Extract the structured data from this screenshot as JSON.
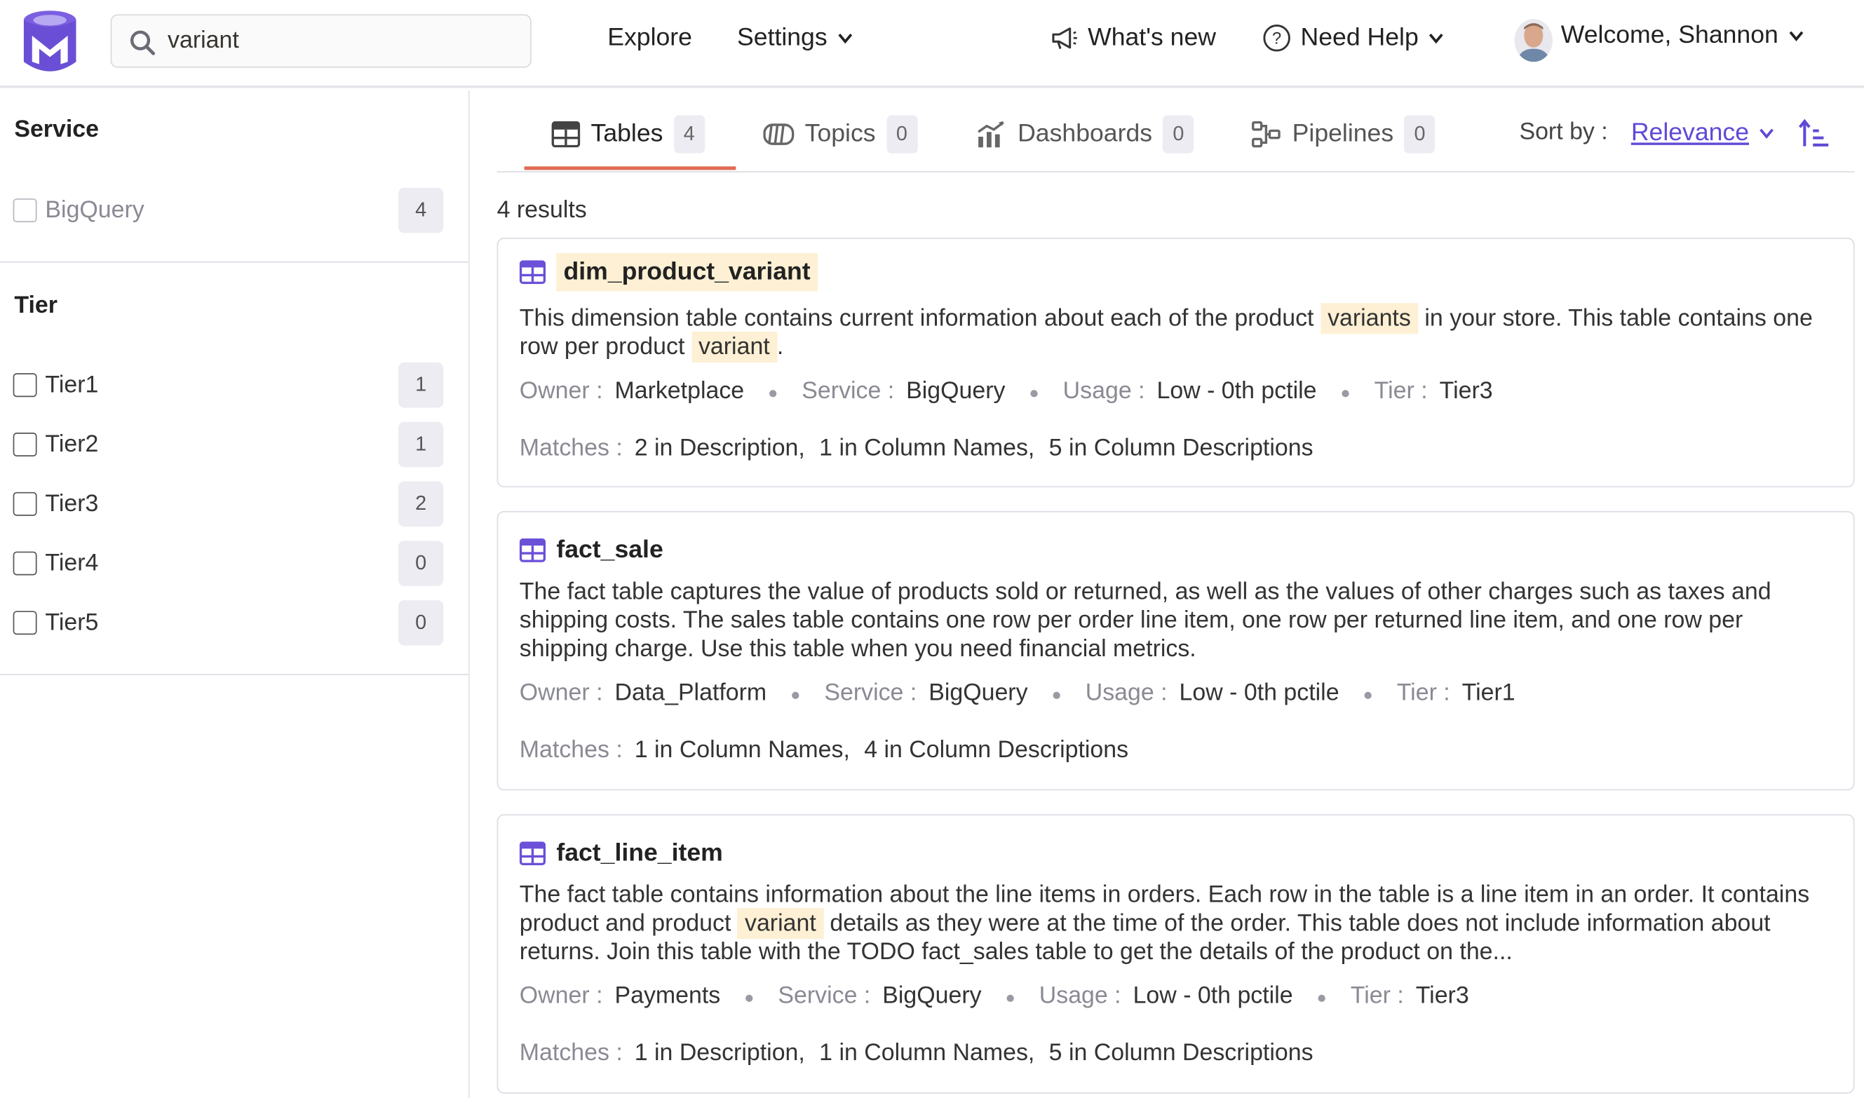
{
  "search": {
    "value": "variant"
  },
  "nav": {
    "explore": "Explore",
    "settings": "Settings",
    "whats_new": "What's new",
    "need_help": "Need Help",
    "welcome": "Welcome, Shannon"
  },
  "sidebar": {
    "service_title": "Service",
    "services": [
      {
        "label": "BigQuery",
        "count": "4"
      }
    ],
    "tier_title": "Tier",
    "tiers": [
      {
        "label": "Tier1",
        "count": "1"
      },
      {
        "label": "Tier2",
        "count": "1"
      },
      {
        "label": "Tier3",
        "count": "2"
      },
      {
        "label": "Tier4",
        "count": "0"
      },
      {
        "label": "Tier5",
        "count": "0"
      }
    ]
  },
  "tabs": [
    {
      "label": "Tables",
      "count": "4",
      "icon": "table-icon"
    },
    {
      "label": "Topics",
      "count": "0",
      "icon": "topic-icon"
    },
    {
      "label": "Dashboards",
      "count": "0",
      "icon": "dashboard-icon"
    },
    {
      "label": "Pipelines",
      "count": "0",
      "icon": "pipeline-icon"
    }
  ],
  "sort": {
    "label": "Sort by :",
    "value": "Relevance"
  },
  "results_count": "4 results",
  "meta_labels": {
    "owner": "Owner :",
    "service": "Service :",
    "usage": "Usage :",
    "tier": "Tier :",
    "matches": "Matches :"
  },
  "cards": [
    {
      "title": "dim_product_variant",
      "desc": [
        "This dimension table contains current information about each of the product ",
        "variants",
        " in your store. This table contains one row per product ",
        "variant",
        "."
      ],
      "owner": "Marketplace",
      "service": "BigQuery",
      "usage": "Low - 0th pctile",
      "tier": "Tier3",
      "matches": [
        "2 in Description,",
        "1 in Column Names,",
        "5 in Column Descriptions"
      ]
    },
    {
      "title": "fact_sale",
      "desc": [
        "The fact table captures the value of products sold or returned, as well as the values of other charges such as taxes and shipping costs. The sales table contains one row per order line item, one row per returned line item, and one row per shipping charge. Use this table when you need financial metrics."
      ],
      "owner": "Data_Platform",
      "service": "BigQuery",
      "usage": "Low - 0th pctile",
      "tier": "Tier1",
      "matches": [
        "1 in Column Names,",
        "4 in Column Descriptions"
      ]
    },
    {
      "title": "fact_line_item",
      "desc": [
        "The fact table contains information about the line items in orders. Each row in the table is a line item in an order. It contains product and product ",
        "variant",
        " details as they were at the time of the order. This table does not include information about returns. Join this table with the TODO fact_sales table to get the details of the product on the..."
      ],
      "owner": "Payments",
      "service": "BigQuery",
      "usage": "Low - 0th pctile",
      "tier": "Tier3",
      "matches": [
        "1 in Description,",
        "1 in Column Names,",
        "5 in Column Descriptions"
      ]
    }
  ],
  "colors": {
    "accent": "#6049d6",
    "highlight": "#fdf0d4",
    "tab_underline": "#e06b52"
  }
}
